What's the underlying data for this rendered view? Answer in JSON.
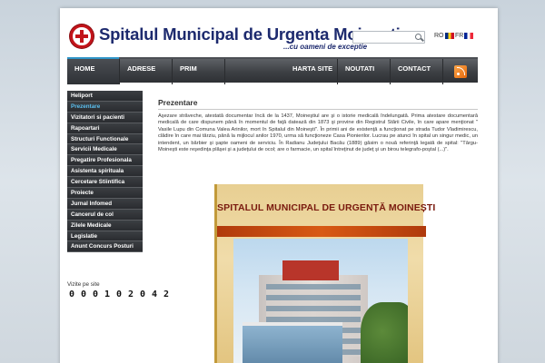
{
  "header": {
    "title": "Spitalul Municipal de Urgenta Moinesti",
    "tagline": "...cu oameni de exceptie",
    "search": {
      "value": "",
      "placeholder": ""
    },
    "languages": [
      {
        "code": "RO",
        "flag": "ro-flag-icon"
      },
      {
        "code": "FR",
        "flag": "fr-flag-icon"
      }
    ]
  },
  "nav": {
    "items": [
      {
        "label": "HOME",
        "active": true
      },
      {
        "label": "ADRESE UTILE"
      },
      {
        "label": "PRIM AJUTOR"
      },
      {
        "label": "HARTA SITE"
      },
      {
        "label": "NOUTATI"
      },
      {
        "label": "CONTACT"
      }
    ],
    "rss_icon": "rss-icon"
  },
  "sidebar": {
    "items": [
      {
        "label": "Heliport"
      },
      {
        "label": "Prezentare",
        "active": true
      },
      {
        "label": "Vizitatori si pacienti"
      },
      {
        "label": "Rapoartari"
      },
      {
        "label": "Structuri Functionale"
      },
      {
        "label": "Servicii Medicale"
      },
      {
        "label": "Pregatire Profesionala"
      },
      {
        "label": "Asistenta spirituala"
      },
      {
        "label": "Cercetare Stiintifica"
      },
      {
        "label": "Proiecte"
      },
      {
        "label": "Jurnal Infomed"
      },
      {
        "label": "Cancerul de col"
      },
      {
        "label": "Zilele Medicale"
      },
      {
        "label": "Legislatie"
      },
      {
        "label": "Anunt Concurs Posturi"
      }
    ],
    "visit_label": "Vizite pe site",
    "counter": [
      "0",
      "0",
      "0",
      "1",
      "0",
      "2",
      "0",
      "4",
      "2"
    ]
  },
  "content": {
    "title": "Prezentare",
    "text": "Aşezare străveche, atestată documentar încă de la 1437, Moineştiul are şi o istorie medicală îndelungată. Prima atestare documentară medicală de care dispunem până în momentul de faţă datează din 1873 şi provine din Registrul Stării Civile, în care apare menţionat \" Vasile Lupu din Comuna Valea Arinilor, mort în Spitalul din Moineşti\". În primii ani de existenţă a funcţionat pe strada Tudor Vladimirescu, clădire în care mai târziu, până la mijlocul anilor 1970, urma să funcţioneze Casa Pionierilor. Lucrau pe atunci în spital un singur medic, un intendent, un bărbier şi şapte oameni de serviciu. În Radianu Judeţului Bacău (1889) găsim o nouă referinţă legată de spital: \"Târgu-Moineşti este reşedinţa plăşei şi a judeţului de ocol; are o farmacie, un spital întreţinut de judeţ şi un birou telegrafo-poştal (...)\".",
    "poster_title": "SPITALUL MUNICIPAL DE URGENȚĂ MOINEȘTI"
  },
  "colors": {
    "title_blue": "#1d2a6e",
    "logo_red": "#c2141a",
    "nav_dark": "#3d4044",
    "active_link": "#5bc0f0"
  }
}
